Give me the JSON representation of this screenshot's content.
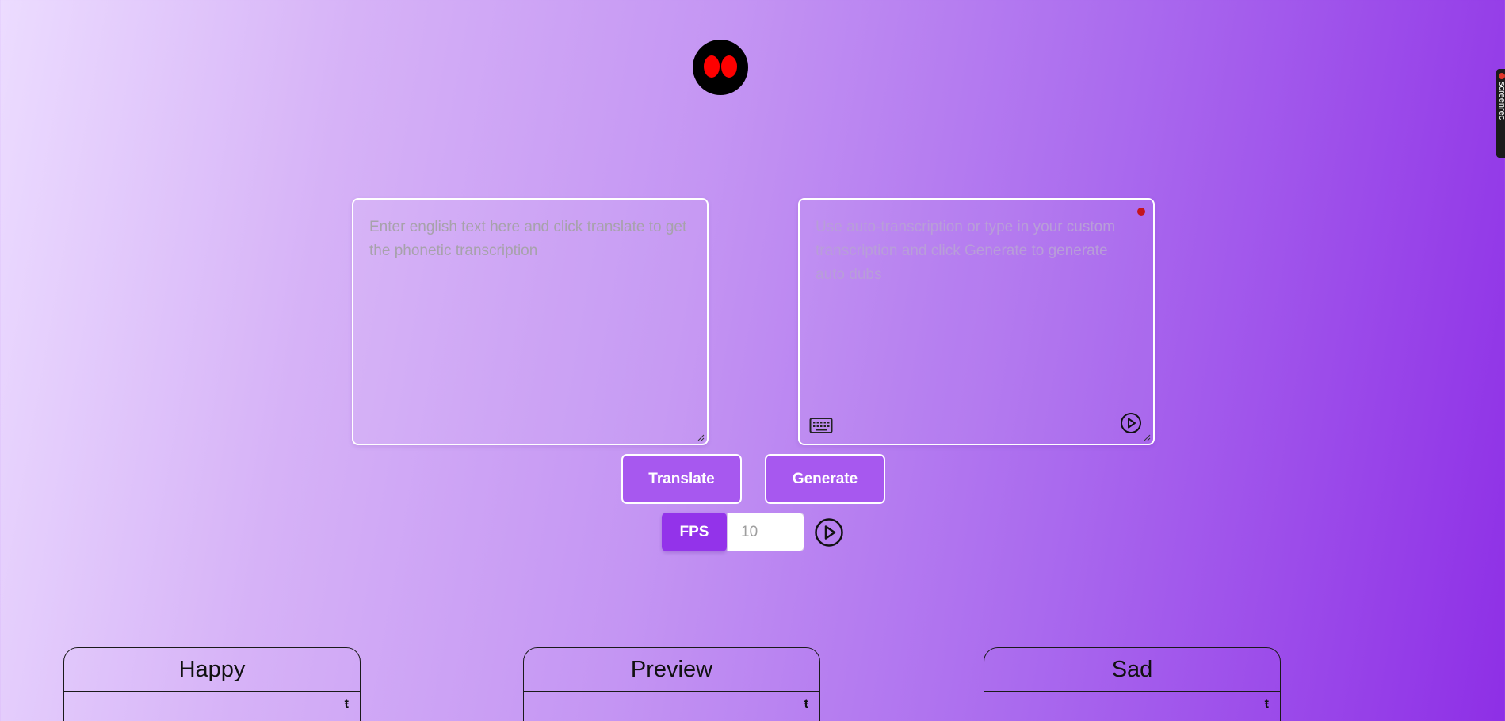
{
  "logo": {
    "icon": "robot-face-icon",
    "face_color": "#000000",
    "eye_color": "#ff0000"
  },
  "side_tab": {
    "label": "screenrec",
    "icon": "record-dot-icon"
  },
  "english_input": {
    "placeholder": "Enter english text here and click translate to get the phonetic transcription",
    "value": ""
  },
  "transcription_input": {
    "placeholder": "Use auto-transcription or type in your custom transcription and click Generate to generate auto dubs",
    "value": "",
    "record_indicator_color": "#c4151c",
    "icons": [
      "keyboard-icon",
      "play-circle-icon"
    ]
  },
  "buttons": {
    "translate_label": "Translate",
    "generate_label": "Generate"
  },
  "fps": {
    "label": "FPS",
    "placeholder": "10",
    "value": ""
  },
  "panels": [
    {
      "title": "Happy",
      "pin": "ŧ"
    },
    {
      "title": "Preview",
      "pin": "ŧ"
    },
    {
      "title": "Sad",
      "pin": "ŧ"
    }
  ],
  "colors": {
    "accent": "#9333ea",
    "button_bg": "#a758ef",
    "gradient_start": "#ecdcff",
    "gradient_end": "#8e2fe6"
  }
}
